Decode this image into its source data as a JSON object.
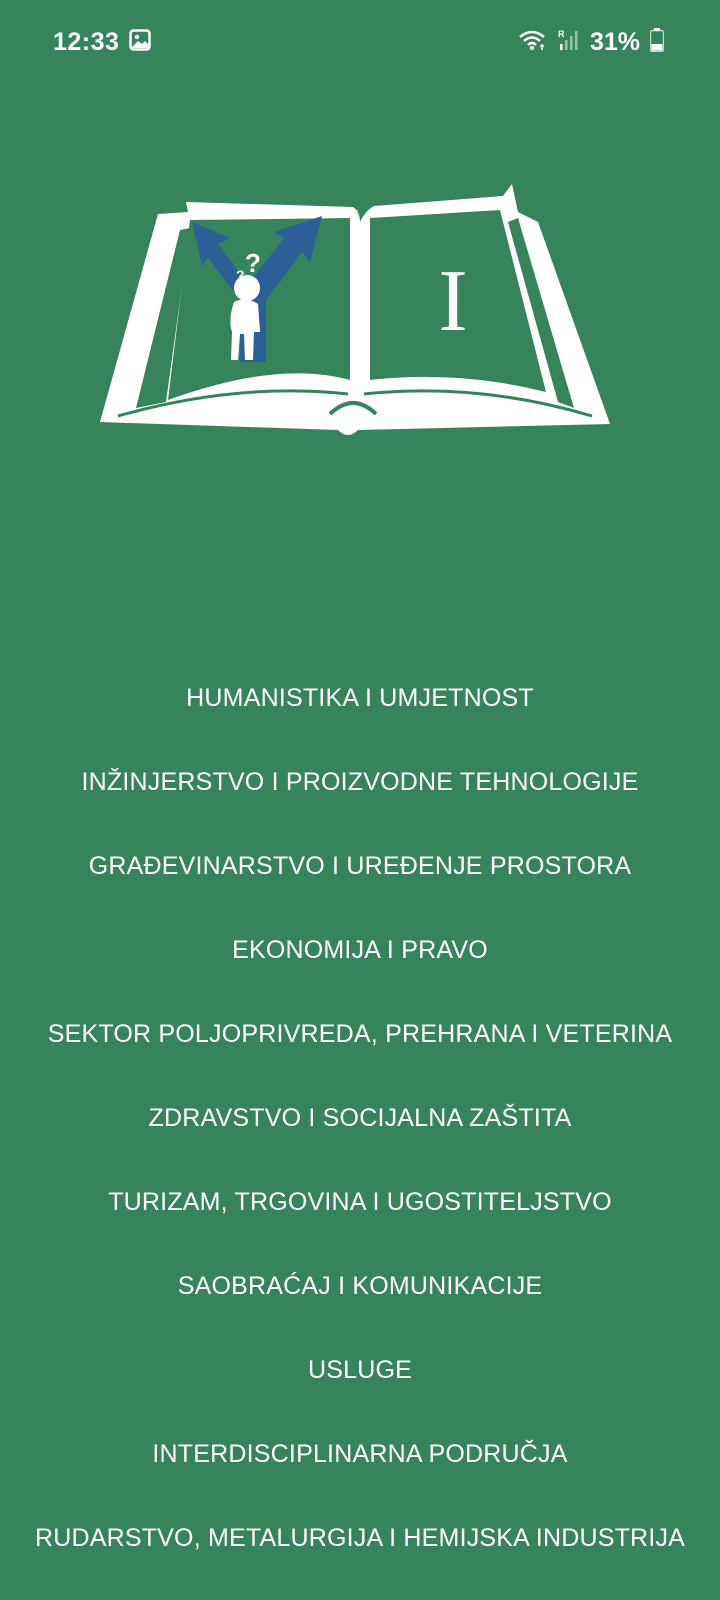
{
  "status_bar": {
    "time": "12:33",
    "battery_percent": "31%",
    "icons": [
      "image-icon",
      "wifi-icon",
      "signal-icon",
      "battery-icon"
    ],
    "roaming_label": "R"
  },
  "logo": {
    "letter": "I"
  },
  "menu": {
    "items": [
      {
        "label": "HUMANISTIKA I UMJETNOST"
      },
      {
        "label": "INŽINJERSTVO I PROIZVODNE TEHNOLOGIJE"
      },
      {
        "label": "GRAĐEVINARSTVO I UREĐENJE PROSTORA"
      },
      {
        "label": "EKONOMIJA I PRAVO"
      },
      {
        "label": "SEKTOR POLJOPRIVREDA, PREHRANA I VETERINA"
      },
      {
        "label": "ZDRAVSTVO I SOCIJALNA ZAŠTITA"
      },
      {
        "label": "TURIZAM, TRGOVINA I UGOSTITELJSTVO"
      },
      {
        "label": "SAOBRAĆAJ I KOMUNIKACIJE"
      },
      {
        "label": "USLUGE"
      },
      {
        "label": "INTERDISCIPLINARNA PODRUČJA"
      },
      {
        "label": "RUDARSTVO, METALURGIJA I HEMIJSKA INDUSTRIJA"
      }
    ]
  },
  "colors": {
    "background": "#37845c",
    "text": "#ffffff",
    "logo_blue": "#2c5f96"
  }
}
